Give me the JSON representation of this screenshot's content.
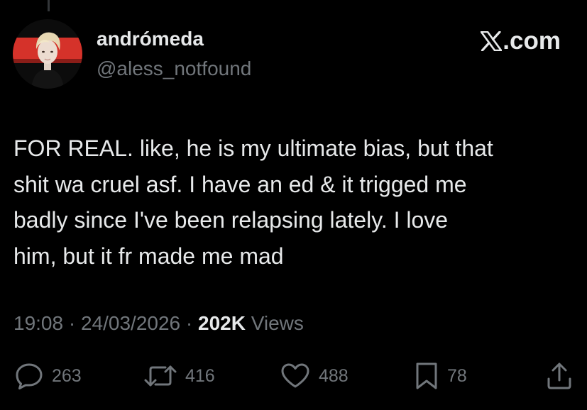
{
  "author": {
    "display_name": "andrómeda",
    "handle": "@aless_notfound"
  },
  "brand": {
    "label": ".com",
    "logo_icon": "x-logo-icon"
  },
  "tweet": {
    "text": "FOR REAL. like, he is my ultimate bias, but that\nshit wa cruel asf. I have an ed & it trigged me\nbadly since I've been relapsing lately. I love\nhim, but it fr made me mad"
  },
  "meta": {
    "time": "19:08",
    "date": "24/03/2026",
    "separator": " · ",
    "views_count": "202K",
    "views_label": " Views"
  },
  "actions": {
    "replies": {
      "icon": "reply-icon",
      "count": "263"
    },
    "reposts": {
      "icon": "repost-icon",
      "count": "416"
    },
    "likes": {
      "icon": "heart-icon",
      "count": "488"
    },
    "bookmarks": {
      "icon": "bookmark-icon",
      "count": "78"
    },
    "share": {
      "icon": "share-icon"
    }
  },
  "colors": {
    "background": "#000000",
    "primary_text": "#e7e9ea",
    "secondary_text": "#71767b",
    "avatar_accent": "#d5322a"
  }
}
